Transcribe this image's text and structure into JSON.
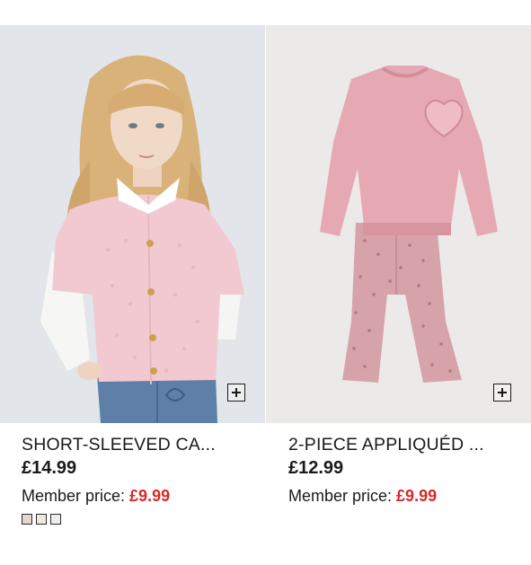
{
  "products": [
    {
      "title": "SHORT-SLEEVED CA...",
      "price": "£14.99",
      "member_label": "Member price:",
      "member_price": "£9.99",
      "image_icon": "photo",
      "quick_add_icon": "plus-square-icon",
      "swatches": [
        "#e7d3cf",
        "#efe8dc",
        "#eeeeec"
      ]
    },
    {
      "title": "2-PIECE APPLIQUÉD ...",
      "price": "£12.99",
      "member_label": "Member price:",
      "member_price": "£9.99",
      "image_icon": "photo",
      "quick_add_icon": "plus-square-icon",
      "swatches": []
    }
  ],
  "colors": {
    "member_price": "#d62a2a",
    "text": "#1a1a1a",
    "image_bg_1": "#e3e6ea",
    "image_bg_2": "#ebeae8"
  }
}
